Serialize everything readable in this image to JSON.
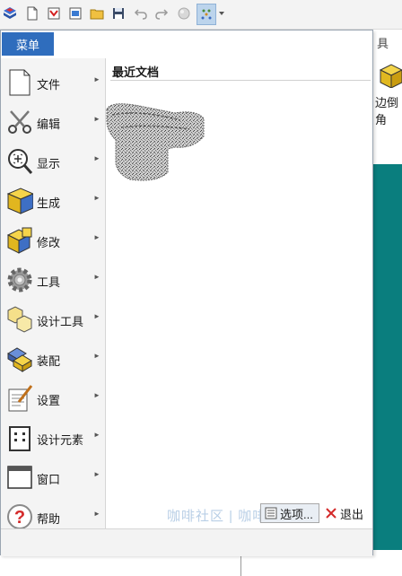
{
  "quick_access": {
    "icons": [
      "app-logo-icon",
      "new-icon",
      "new-from-template-icon",
      "open-icon",
      "folder-icon",
      "save-icon",
      "undo-icon",
      "redo-icon",
      "render-icon",
      "active-tool-icon",
      "customize-dropdown-icon"
    ]
  },
  "behind": {
    "ribbon_fragment_top": "具",
    "ribbon_fragment_label": "边倒角"
  },
  "menu": {
    "tab_label": "菜单",
    "items": [
      {
        "label": "文件",
        "icon": "file-icon"
      },
      {
        "label": "编辑",
        "icon": "scissors-icon"
      },
      {
        "label": "显示",
        "icon": "magnify-icon"
      },
      {
        "label": "生成",
        "icon": "cube-generate-icon"
      },
      {
        "label": "修改",
        "icon": "cube-modify-icon"
      },
      {
        "label": "工具",
        "icon": "gear-icon"
      },
      {
        "label": "设计工具",
        "icon": "design-tools-icon"
      },
      {
        "label": "装配",
        "icon": "assembly-icon"
      },
      {
        "label": "设置",
        "icon": "settings-document-icon"
      },
      {
        "label": "设计元素",
        "icon": "design-element-icon"
      },
      {
        "label": "窗口",
        "icon": "window-icon"
      },
      {
        "label": "帮助",
        "icon": "help-icon"
      }
    ],
    "recent_title": "最近文档",
    "options_label": "选项...",
    "exit_label": "退出",
    "watermark": "咖啡社区 | 咖啡大方"
  },
  "colors": {
    "accent": "#2f6dbd",
    "viewport": "#0a7e7e"
  }
}
